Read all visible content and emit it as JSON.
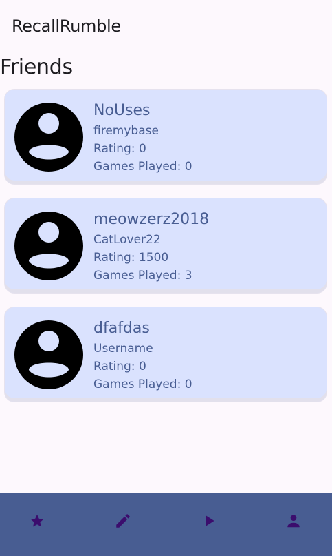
{
  "app": {
    "title": "RecallRumble"
  },
  "friends_section": {
    "title": "Friends",
    "friends": [
      {
        "name": "NoUses",
        "username": "firemybase",
        "rating": "Rating: 0",
        "games_played": "Games Played: 0"
      },
      {
        "name": "meowzerz2018",
        "username": "CatLover22",
        "rating": "Rating: 1500",
        "games_played": "Games Played: 3"
      },
      {
        "name": "dfafdas",
        "username": "Username",
        "rating": "Rating: 0",
        "games_played": "Games Played: 0"
      }
    ]
  },
  "bottom_nav": {
    "items": [
      {
        "icon": "star-icon"
      },
      {
        "icon": "pencil-icon"
      },
      {
        "icon": "play-icon"
      },
      {
        "icon": "person-icon"
      }
    ]
  },
  "colors": {
    "background": "#fdf8fd",
    "card_background": "#dae2fe",
    "card_text": "#485d92",
    "nav_background": "#485d92",
    "nav_icon": "#3b0d6d"
  }
}
